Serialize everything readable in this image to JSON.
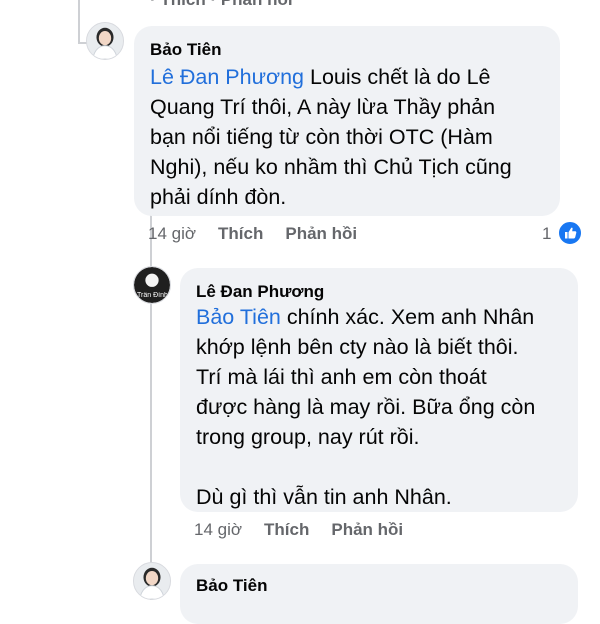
{
  "top_partial": {
    "text": "·  Thích  ·  Phản hồi"
  },
  "comments": [
    {
      "author": "Bảo Tiên",
      "mention": "Lê Đan Phương",
      "lines_after_mention": " Louis chết là do Lê",
      "lines": [
        "Quang Trí thôi, A này lừa Thầy phản",
        "bạn nổi tiếng từ còn thời OTC (Hàm",
        "Nghi), nếu ko nhầm thì Chủ Tịch cũng",
        "phải dính đòn."
      ],
      "time": "14 giờ",
      "like_label": "Thích",
      "reply_label": "Phản hồi",
      "reaction_count": "1",
      "reaction_icon": "like-icon"
    },
    {
      "author": "Lê Đan Phương",
      "avatar_caption": "Trần Đình",
      "mention": "Bảo Tiên",
      "first_line_after_mention": " chính xác. Xem anh Nhân",
      "lines": [
        "khớp lệnh bên cty nào là biết thôi.",
        "Trí mà lái thì anh em còn thoát",
        "được hàng là may rồi. Bữa ổng còn",
        "trong group, nay rút rồi.",
        "",
        "Dù gì thì vẫn tin anh Nhân."
      ],
      "time": "14 giờ",
      "like_label": "Thích",
      "reply_label": "Phản hồi"
    },
    {
      "author": "Bảo Tiên"
    }
  ],
  "colors": {
    "mention": "#216fdb",
    "bubble": "#f0f2f5",
    "meta": "#65676b",
    "like_badge": "#1877f2"
  }
}
